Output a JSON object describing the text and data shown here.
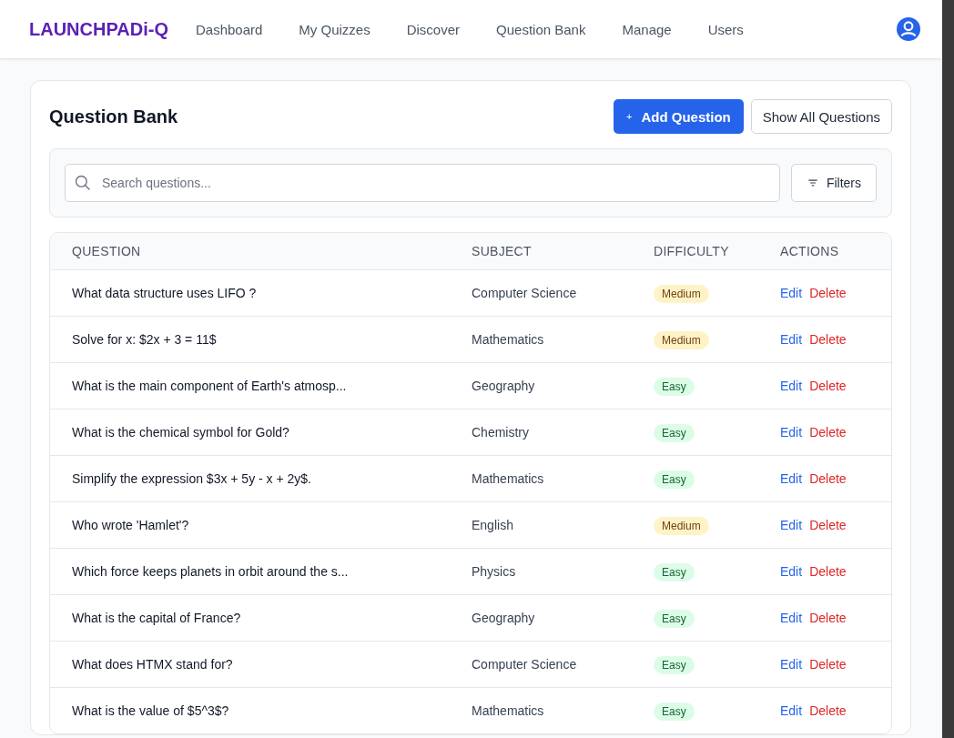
{
  "nav": {
    "brand": "LAUNCHPADi-Q",
    "links": [
      "Dashboard",
      "My Quizzes",
      "Discover",
      "Question Bank",
      "Manage",
      "Users"
    ]
  },
  "page": {
    "title": "Question Bank",
    "add_button": "+",
    "add_label": "Add Question",
    "show_all_button": "Show All Questions"
  },
  "search": {
    "placeholder": "Search questions...",
    "filters_button": "Filters"
  },
  "table": {
    "columns": [
      "QUESTION",
      "SUBJECT",
      "DIFFICULTY",
      "ACTIONS"
    ],
    "rows": [
      {
        "question": "What data structure uses LIFO ?",
        "subject": "Computer Science",
        "difficulty": "Medium",
        "kind": "warning",
        "edit": "Edit",
        "delete": "Delete"
      },
      {
        "question": "Solve for x: $2x + 3 = 11$",
        "subject": "Mathematics",
        "difficulty": "Medium",
        "kind": "warning",
        "edit": "Edit",
        "delete": "Delete"
      },
      {
        "question": "What is the main component of Earth's atmosp...",
        "subject": "Geography",
        "difficulty": "Easy",
        "kind": "success",
        "edit": "Edit",
        "delete": "Delete"
      },
      {
        "question": "What is the chemical symbol for Gold?",
        "subject": "Chemistry",
        "difficulty": "Easy",
        "kind": "success",
        "edit": "Edit",
        "delete": "Delete"
      },
      {
        "question": "Simplify the expression $3x + 5y - x + 2y$.",
        "subject": "Mathematics",
        "difficulty": "Easy",
        "kind": "success",
        "edit": "Edit",
        "delete": "Delete"
      },
      {
        "question": "Who wrote 'Hamlet'?",
        "subject": "English",
        "difficulty": "Medium",
        "kind": "warning",
        "edit": "Edit",
        "delete": "Delete"
      },
      {
        "question": "Which force keeps planets in orbit around the s...",
        "subject": "Physics",
        "difficulty": "Easy",
        "kind": "success",
        "edit": "Edit",
        "delete": "Delete"
      },
      {
        "question": "What is the capital of France?",
        "subject": "Geography",
        "difficulty": "Easy",
        "kind": "success",
        "edit": "Edit",
        "delete": "Delete"
      },
      {
        "question": "What does HTMX stand for?",
        "subject": "Computer Science",
        "difficulty": "Easy",
        "kind": "success",
        "edit": "Edit",
        "delete": "Delete"
      },
      {
        "question": "What is the value of $5^3$?",
        "subject": "Mathematics",
        "difficulty": "Easy",
        "kind": "success",
        "edit": "Edit",
        "delete": "Delete"
      }
    ]
  }
}
